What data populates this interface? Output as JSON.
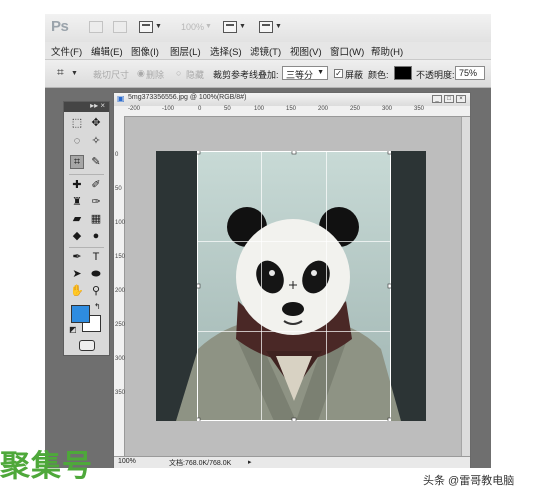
{
  "app": {
    "logo": "Ps"
  },
  "topbar": {
    "zoom": "100%"
  },
  "menu": [
    "文件(F)",
    "编辑(E)",
    "图像(I)",
    "图层(L)",
    "选择(S)",
    "滤镜(T)",
    "视图(V)",
    "窗口(W)",
    "帮助(H)"
  ],
  "options": {
    "size_label": "裁切尺寸",
    "delete_label": "删除",
    "hide_label": "隐藏",
    "overlay_label": "裁剪参考线叠加:",
    "overlay_value": "三等分",
    "shield_label": "屏蔽",
    "color_label": "颜色:",
    "opacity_label": "不透明度:",
    "opacity_value": "75%"
  },
  "colors": {
    "foreground": "#2e8ce0",
    "background": "#ffffff",
    "shield": "#000000"
  },
  "document": {
    "title": "5mg373356556.jpg @ 100%(RGB/8#)",
    "status_zoom": "100%",
    "status_doc": "文档:768.0K/768.0K",
    "ruler_top": [
      "-200",
      "-100",
      "0",
      "50",
      "100",
      "150",
      "200",
      "250",
      "300",
      "350"
    ],
    "ruler_left": [
      "0",
      "50",
      "100",
      "150",
      "200",
      "250",
      "300",
      "350"
    ]
  },
  "watermarks": {
    "left": "聚集号",
    "right": "头条 @雷哥教电脑"
  }
}
